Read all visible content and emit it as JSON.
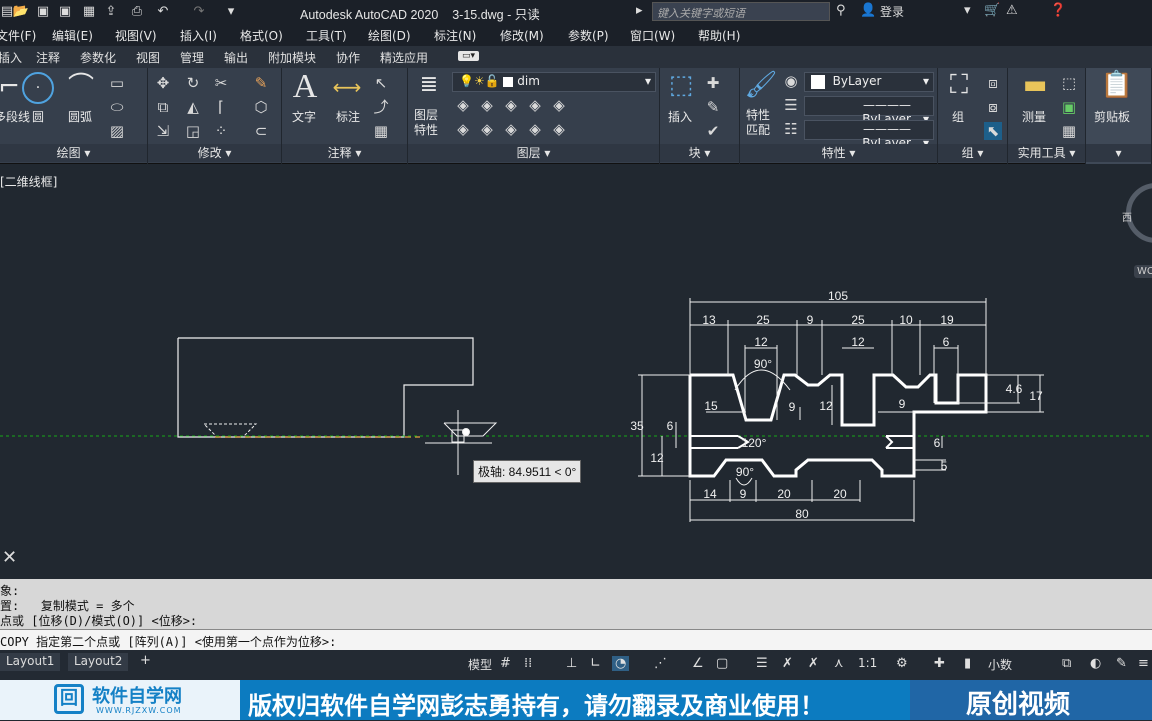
{
  "titlebar": {
    "app": "Autodesk AutoCAD 2020",
    "file": "3-15.dwg - 只读",
    "search_placeholder": "键入关键字或短语",
    "login": "登录"
  },
  "menu": [
    "文件(F)",
    "编辑(E)",
    "视图(V)",
    "插入(I)",
    "格式(O)",
    "工具(T)",
    "绘图(D)",
    "标注(N)",
    "修改(M)",
    "参数(P)",
    "窗口(W)",
    "帮助(H)"
  ],
  "tabs": [
    "插入",
    "注释",
    "参数化",
    "视图",
    "管理",
    "输出",
    "附加模块",
    "协作",
    "精选应用"
  ],
  "ribbon": {
    "draw": {
      "title": "绘图",
      "polyline": "多段线",
      "circle": "圆",
      "arc": "圆弧"
    },
    "modify": {
      "title": "修改"
    },
    "annotate": {
      "title": "注释",
      "text": "文字",
      "dim": "标注"
    },
    "layers": {
      "title": "图层",
      "props": "图层\n特性",
      "current": "dim"
    },
    "block": {
      "title": "块",
      "insert": "插入"
    },
    "properties": {
      "title": "特性",
      "match": "特性\n匹配",
      "color": "ByLayer",
      "linetype": "ByLayer",
      "lineweight": "ByLayer"
    },
    "groups": {
      "title": "组",
      "group": "组"
    },
    "utilities": {
      "title": "实用工具",
      "measure": "测量"
    },
    "clipboard": {
      "paste": "剪贴板"
    }
  },
  "viewport": {
    "label": "[二维线框]",
    "compass_w": "西",
    "wcs": "WCS",
    "tooltip": "极轴: 84.9511 < 0°"
  },
  "drawing_dims": {
    "overall": "105",
    "top": [
      "13",
      "25",
      "9",
      "25",
      "10",
      "19"
    ],
    "w12a": "12",
    "w12b": "12",
    "w6": "6",
    "angle90a": "90°",
    "angle120": "120°",
    "angle90b": "90°",
    "d9": "9",
    "d12": "12",
    "d15": "15",
    "d9b": "9",
    "right46": "4.6",
    "right17": "17",
    "right6": "6",
    "right5": "5",
    "left35": "35",
    "left6": "6",
    "left12": "12",
    "bottom": [
      "14",
      "9",
      "20",
      "20"
    ],
    "bottom_total": "80"
  },
  "command": {
    "line1": "象:",
    "line2": "置:   复制模式 = 多个",
    "line3": "点或 [位移(D)/模式(O)] <位移>:",
    "prompt": "COPY 指定第二个点或 [阵列(A)] <使用第一个点作为位移>:"
  },
  "status": {
    "layout1": "Layout1",
    "layout2": "Layout2",
    "model": "模型",
    "scale": "1:1",
    "units": "小数"
  },
  "banner": {
    "logo": "软件自学网",
    "url": "WWW.RJZXW.COM",
    "notice": "版权归软件自学网彭志勇持有，请勿翻录及商业使用！",
    "tag": "原创视频"
  }
}
